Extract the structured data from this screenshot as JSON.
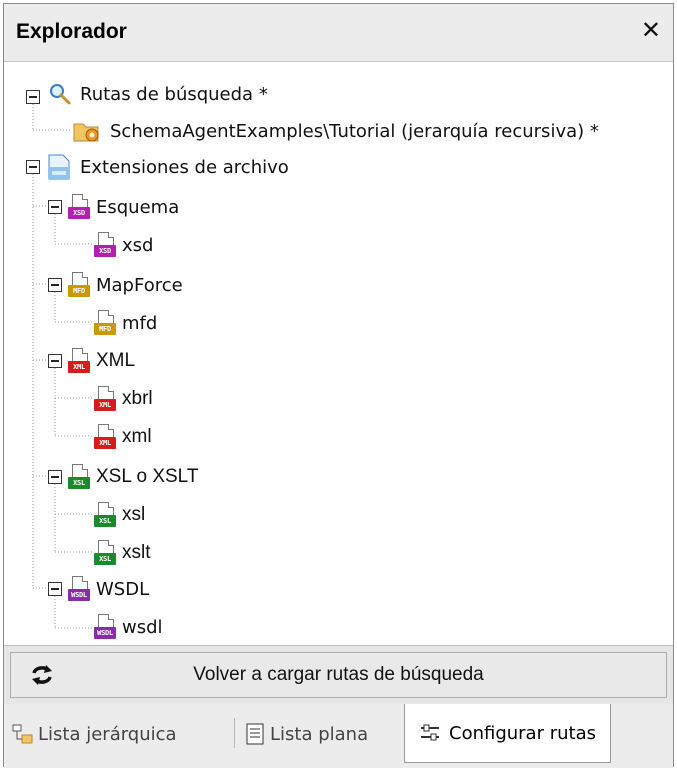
{
  "window": {
    "title": "Explorador",
    "close_glyph": "✕"
  },
  "tree": {
    "search_paths": {
      "label": "Rutas de búsqueda *",
      "child": "SchemaAgentExamples\\Tutorial (jerarquía recursiva) *"
    },
    "file_extensions": {
      "label": "Extensiones de archivo"
    },
    "groups": [
      {
        "label": "Esquema",
        "badge": "XSD",
        "color": "#b21fb2",
        "children": [
          "xsd"
        ]
      },
      {
        "label": "MapForce",
        "badge": "MFD",
        "color": "#c99a00",
        "children": [
          "mfd"
        ]
      },
      {
        "label": "XML",
        "badge": "XML",
        "color": "#d81b1b",
        "children": [
          "xbrl",
          "xml"
        ]
      },
      {
        "label": "XSL o XSLT",
        "badge": "XSL",
        "color": "#1a8a2b",
        "children": [
          "xsl",
          "xslt"
        ]
      },
      {
        "label": "WSDL",
        "badge": "WSDL",
        "color": "#8a2ba8",
        "children": [
          "wsdl"
        ]
      }
    ]
  },
  "reload_button": {
    "label": "Volver a cargar rutas de búsqueda"
  },
  "tabs": [
    {
      "label": "Lista jerárquica",
      "active": false
    },
    {
      "label": "Lista plana",
      "active": false
    },
    {
      "label": "Configurar rutas",
      "active": true
    }
  ]
}
